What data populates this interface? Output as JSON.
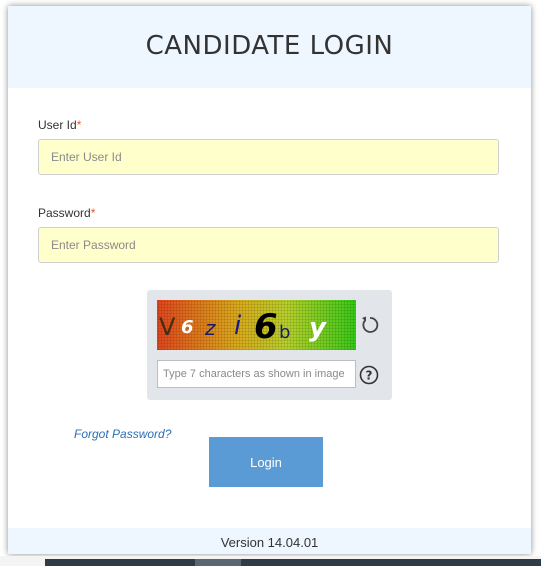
{
  "header": {
    "title": "CANDIDATE LOGIN"
  },
  "form": {
    "user_id": {
      "label": "User Id",
      "required_mark": "*",
      "placeholder": "Enter User Id",
      "value": ""
    },
    "password": {
      "label": "Password",
      "required_mark": "*",
      "placeholder": "Enter Password",
      "value": ""
    }
  },
  "captcha": {
    "characters": [
      "V",
      "6",
      "z",
      "i",
      "6",
      "b",
      "y"
    ],
    "input_placeholder": "Type 7 characters as shown in image",
    "refresh_icon": "refresh-icon",
    "help_icon": "help-icon"
  },
  "links": {
    "forgot_password": "Forgot Password?"
  },
  "buttons": {
    "login": "Login"
  },
  "footer": {
    "version": "Version 14.04.01"
  },
  "colors": {
    "header_bg": "#eef6ff",
    "input_bg": "#ffffcc",
    "required": "#e8552f",
    "link": "#2b6fb5",
    "button": "#5b9bd5"
  }
}
